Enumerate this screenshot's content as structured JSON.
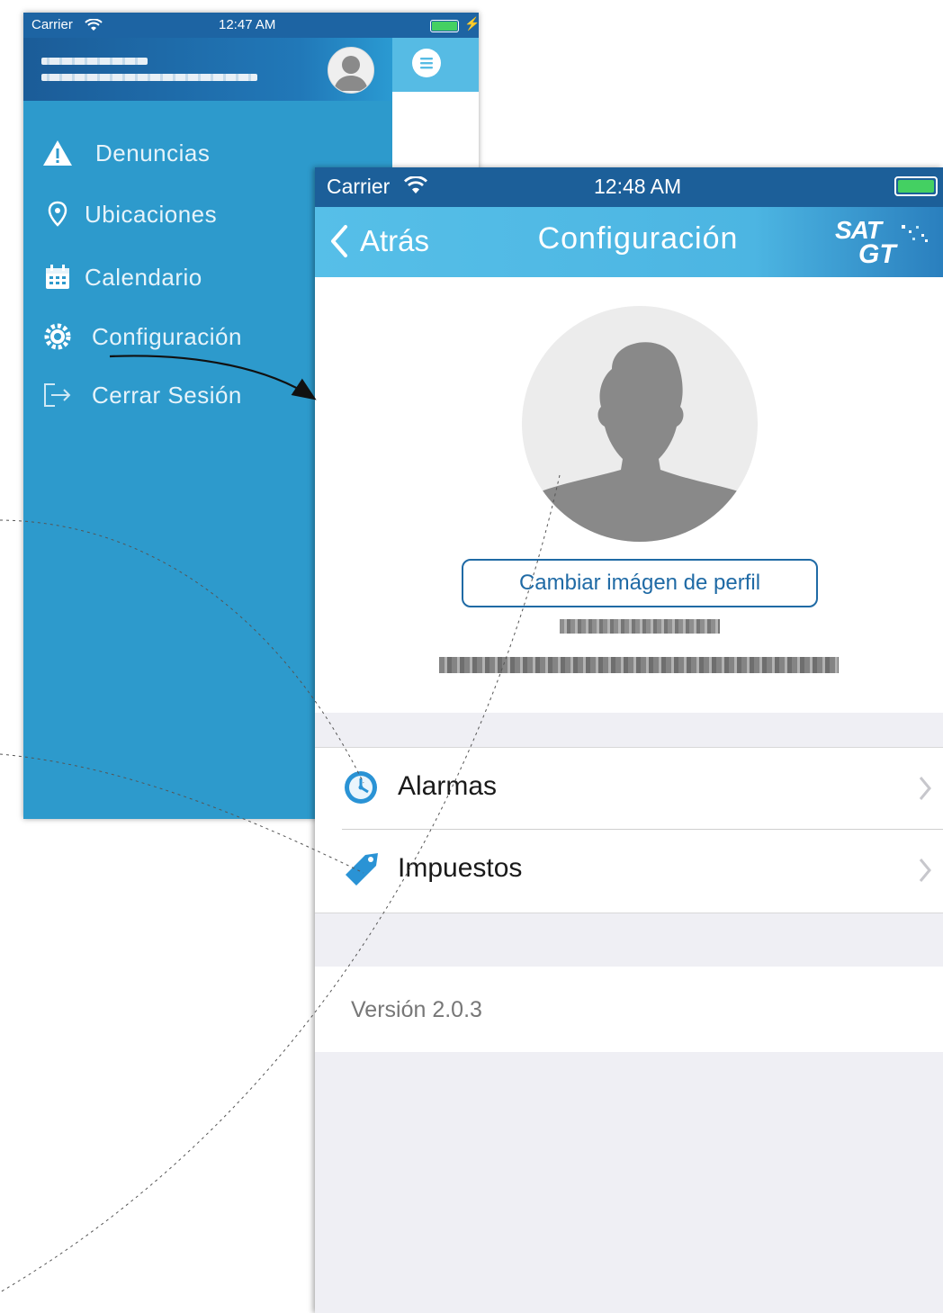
{
  "phone1": {
    "status": {
      "carrier": "Carrier",
      "time": "12:47 AM"
    },
    "menu": [
      {
        "label": "Denuncias",
        "icon": "warning-icon"
      },
      {
        "label": "Ubicaciones",
        "icon": "location-pin-icon"
      },
      {
        "label": "Calendario",
        "icon": "calendar-icon"
      },
      {
        "label": "Configuración",
        "icon": "gear-icon"
      },
      {
        "label": "Cerrar Sesión",
        "icon": "logout-icon"
      }
    ]
  },
  "phone2": {
    "status": {
      "carrier": "Carrier",
      "time": "12:48 AM"
    },
    "nav": {
      "back_label": "Atrás",
      "title": "Configuración",
      "logo_line1": "SAT",
      "logo_line2": "GT"
    },
    "profile": {
      "change_image_label": "Cambiar imágen de perfil"
    },
    "rows": [
      {
        "label": "Alarmas",
        "icon": "alarm-clock-icon"
      },
      {
        "label": "Impuestos",
        "icon": "tag-icon"
      }
    ],
    "version": "Versión 2.0.3"
  },
  "colors": {
    "menu_bg": "#2d9acc",
    "nav_bg": "#4cb5e2",
    "status_bg": "#1c5f99",
    "accent": "#1d6ea8"
  }
}
